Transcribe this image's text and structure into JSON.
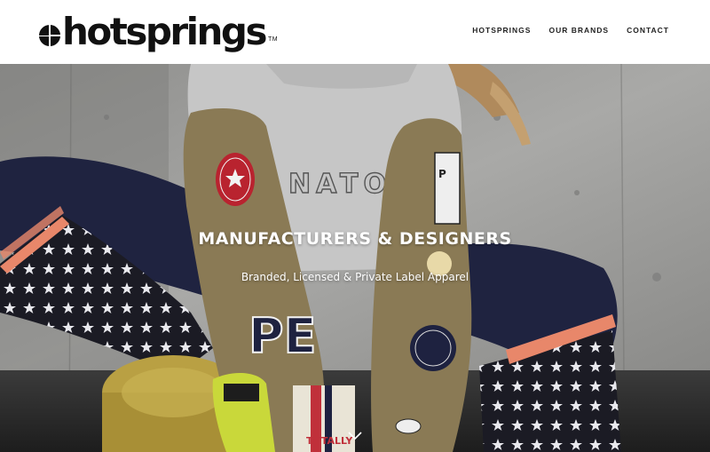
{
  "header": {
    "logo_text": "hotsprings",
    "logo_tm": "TM"
  },
  "nav": {
    "items": [
      {
        "label": "HOTSPRINGS"
      },
      {
        "label": "OUR BRANDS"
      },
      {
        "label": "CONTACT"
      }
    ]
  },
  "hero": {
    "title": "MANUFACTURERS & DESIGNERS",
    "subtitle": "Branded, Licensed & Private Label Apparel",
    "scroll_icon": "chevron-down-icon"
  },
  "photo": {
    "sweatshirt_print": "NATO",
    "patch_letters": "PE",
    "patch_totally": "TOTALLY",
    "colors": {
      "wall": "#9c9c9a",
      "legging_navy": "#1e2240",
      "sherpa_olive": "#8a7a55",
      "sweatshirt_grey": "#c9c9c9",
      "accent_coral": "#e8876a",
      "weight_gold": "#b9a043"
    }
  }
}
